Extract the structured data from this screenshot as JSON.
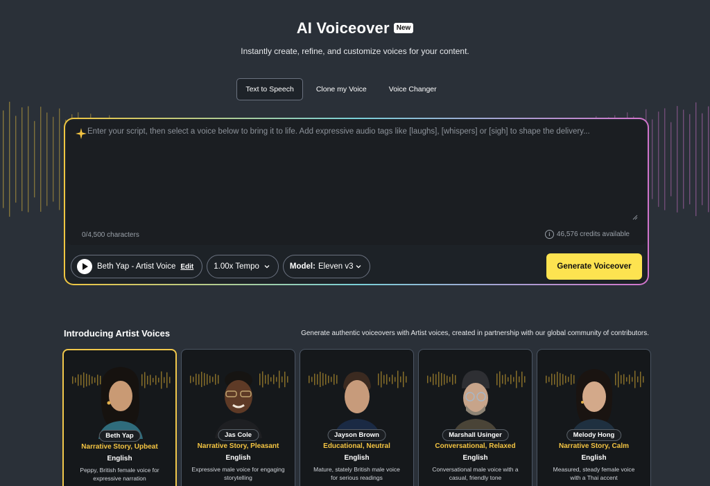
{
  "header": {
    "title": "AI Voiceover",
    "badge": "New",
    "subtitle": "Instantly create, refine, and customize voices for your content."
  },
  "tabs": [
    {
      "label": "Text to Speech",
      "active": true
    },
    {
      "label": "Clone my Voice",
      "active": false
    },
    {
      "label": "Voice Changer",
      "active": false
    }
  ],
  "editor": {
    "placeholder": "Enter your script, then select a voice below to bring it to life. Add expressive audio tags like [laughs], [whispers] or [sigh] to shape the delivery...",
    "value": "",
    "char_count": "0/4,500 characters",
    "credits": "46,576 credits available"
  },
  "controls": {
    "voice": "Beth Yap - Artist Voice",
    "edit_label": "Edit",
    "tempo": "1.00x Tempo",
    "model_label": "Model:",
    "model_value": "Eleven v3",
    "generate_label": "Generate Voiceover"
  },
  "section": {
    "title": "Introducing Artist Voices",
    "description": "Generate authentic voiceovers with Artist voices, created in partnership with our global community of contributors."
  },
  "voices": [
    {
      "name": "Beth Yap",
      "tags": "Narrative Story, Upbeat",
      "language": "English",
      "description": "Peppy, British female voice for expressive narration",
      "selected": true
    },
    {
      "name": "Jas Cole",
      "tags": "Narrative Story, Pleasant",
      "language": "English",
      "description": "Expressive male voice for engaging storytelling",
      "selected": false
    },
    {
      "name": "Jayson Brown",
      "tags": "Educational, Neutral",
      "language": "English",
      "description": "Mature, stately British male voice for serious readings",
      "selected": false
    },
    {
      "name": "Marshall Usinger",
      "tags": "Conversational, Relaxed",
      "language": "English",
      "description": "Conversational male voice with a casual, friendly tone",
      "selected": false
    },
    {
      "name": "Melody Hong",
      "tags": "Narrative Story, Calm",
      "language": "English",
      "description": "Measured, steady female voice with a Thai accent",
      "selected": false
    }
  ],
  "colors": {
    "background": "#2a3038",
    "accent_yellow": "#fde350",
    "tag_yellow": "#f5c542",
    "gradient": [
      "#f0c640",
      "#7ad0d8",
      "#d274cc"
    ]
  }
}
